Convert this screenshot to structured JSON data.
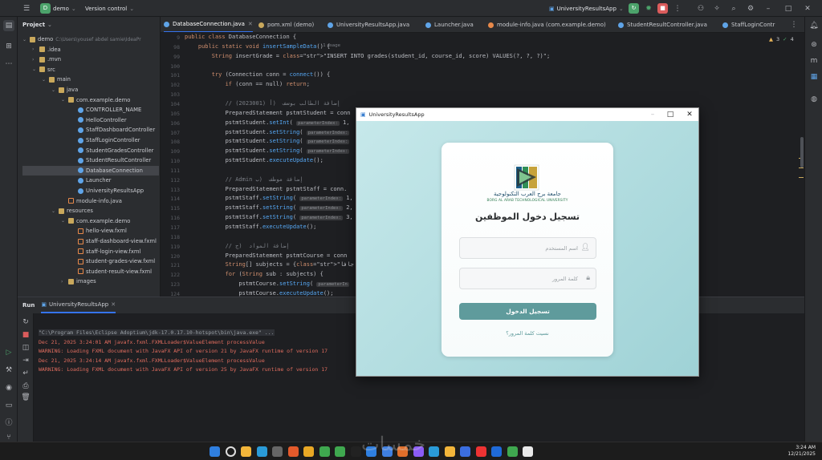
{
  "ide": {
    "project_name": "demo",
    "version_control": "Version control",
    "run_config": "UniversityResultsApp",
    "project_panel_title": "Project",
    "editor_warnings": "3",
    "editor_checks": "4",
    "usage_hint": "1 usage"
  },
  "tree": [
    {
      "indent": 0,
      "label": "demo",
      "note": "C:\\Users\\yousef abdel samie\\IdeaPr",
      "type": "folder",
      "open": true
    },
    {
      "indent": 1,
      "label": ".idea",
      "type": "folder",
      "open": false
    },
    {
      "indent": 1,
      "label": ".mvn",
      "type": "folder",
      "open": false
    },
    {
      "indent": 1,
      "label": "src",
      "type": "folder",
      "open": true
    },
    {
      "indent": 2,
      "label": "main",
      "type": "folder",
      "open": true
    },
    {
      "indent": 3,
      "label": "java",
      "type": "folder",
      "open": true
    },
    {
      "indent": 4,
      "label": "com.example.demo",
      "type": "package",
      "open": true
    },
    {
      "indent": 5,
      "label": "CONTROLLER_NAME",
      "type": "class"
    },
    {
      "indent": 5,
      "label": "HelloController",
      "type": "class"
    },
    {
      "indent": 5,
      "label": "StaffDashboardController",
      "type": "class"
    },
    {
      "indent": 5,
      "label": "StaffLoginController",
      "type": "class"
    },
    {
      "indent": 5,
      "label": "StudentGradesController",
      "type": "class"
    },
    {
      "indent": 5,
      "label": "StudentResultController",
      "type": "class"
    },
    {
      "indent": 5,
      "label": "DatabaseConnection",
      "type": "class",
      "selected": true
    },
    {
      "indent": 5,
      "label": "Launcher",
      "type": "class"
    },
    {
      "indent": 5,
      "label": "UniversityResultsApp",
      "type": "class"
    },
    {
      "indent": 4,
      "label": "module-info.java",
      "type": "java"
    },
    {
      "indent": 3,
      "label": "resources",
      "type": "folder",
      "open": true
    },
    {
      "indent": 4,
      "label": "com.example.demo",
      "type": "package",
      "open": true
    },
    {
      "indent": 5,
      "label": "hello-view.fxml",
      "type": "fxml"
    },
    {
      "indent": 5,
      "label": "staff-dashboard-view.fxml",
      "type": "fxml"
    },
    {
      "indent": 5,
      "label": "staff-login-view.fxml",
      "type": "fxml"
    },
    {
      "indent": 5,
      "label": "student-grades-view.fxml",
      "type": "fxml"
    },
    {
      "indent": 5,
      "label": "student-result-view.fxml",
      "type": "fxml"
    },
    {
      "indent": 4,
      "label": "images",
      "type": "folder",
      "open": false
    }
  ],
  "tabs": [
    "DatabaseConnection.java",
    "pom.xml (demo)",
    "UniversityResultsApp.java",
    "Launcher.java",
    "module-info.java (com.example.demo)",
    "StudentResultController.java",
    "StaffLoginContr"
  ],
  "line_numbers": [
    "9",
    "98",
    "99",
    "100",
    "101",
    "102",
    "103",
    "104",
    "105",
    "106",
    "107",
    "108",
    "109",
    "110",
    "111",
    "112",
    "113",
    "114",
    "115",
    "116",
    "117",
    "118",
    "119",
    "120",
    "121",
    "122",
    "123",
    "124"
  ],
  "code_lines": [
    "public class DatabaseConnection {",
    "    public static void insertSampleData() {",
    "        String insertGrade = \"INSERT INTO grades(student_id, course_id, score) VALUES(?, ?, ?)\";",
    "",
    "        try (Connection conn = connect()) {",
    "            if (conn == null) return;",
    "",
    "            // (2023001) إضافة الطالب بوسف  (أ",
    "            PreparedStatement pstmtStudent = conn",
    "            pstmtStudent.setInt( parameterIndex: 1,",
    "            pstmtStudent.setString( parameterIndex:",
    "            pstmtStudent.setString( parameterIndex:",
    "            pstmtStudent.setString( parameterIndex:",
    "            pstmtStudent.executeUpdate();",
    "",
    "            // Admin إضافة موظف  (ب",
    "            PreparedStatement pstmtStaff = conn.",
    "            pstmtStaff.setString( parameterIndex: 1,",
    "            pstmtStaff.setString( parameterIndex: 2,",
    "            pstmtStaff.setString( parameterIndex: 3,",
    "            pstmtStaff.executeUpdate();",
    "",
    "            // إضافة المواد  (ج",
    "            PreparedStatement pstmtCourse = conn",
    "            String[] subjects = {\"برمجة جافا\", \"",
    "            for (String sub : subjects) {",
    "                pstmtCourse.setString( parameterIn",
    "                pstmtCourse.executeUpdate();"
  ],
  "run": {
    "label": "Run",
    "config_tab": "UniversityResultsApp",
    "lines": [
      {
        "kind": "cmd",
        "text": "\"C:\\Program Files\\Eclipse Adoptium\\jdk-17.0.17.10-hotspot\\bin\\java.exe\" ..."
      },
      {
        "kind": "err",
        "text": "Dec 21, 2025 3:24:01 AM javafx.fxml.FXMLLoader$ValueElement processValue"
      },
      {
        "kind": "err",
        "text": "WARNING: Loading FXML document with JavaFX API of version 21 by JavaFX runtime of version 17"
      },
      {
        "kind": "err",
        "text": "Dec 21, 2025 3:24:14 AM javafx.fxml.FXMLLoader$ValueElement processValue"
      },
      {
        "kind": "err",
        "text": "WARNING: Loading FXML document with JavaFX API of version 25 by JavaFX runtime of version 17"
      }
    ]
  },
  "app": {
    "window_title": "UniversityResultsApp",
    "university_ar": "جامعة برج العرب التكنولوجية",
    "university_en": "BORG AL ARAB TECHNOLOGICAL UNIVERSITY",
    "heading": "تسجيل دخول الموظفين",
    "username_placeholder": "اسم المستخدم",
    "password_placeholder": "كلمة المرور",
    "login_button": "تسجيل الدخول",
    "forgot_link": "نسيت كلمة المرور؟",
    "colors": {
      "button": "#5f9b9c",
      "bg_start": "#c6e8ea",
      "bg_end": "#9fd2d6",
      "link": "#5f9b9c"
    }
  },
  "taskbar": {
    "time": "3:24 AM",
    "date": "12/21/2025",
    "watermark": "خمسات"
  },
  "colors": {
    "accent": "#3574f0",
    "error_text": "#e06c5e",
    "cmd_text": "#9aa0a6"
  }
}
